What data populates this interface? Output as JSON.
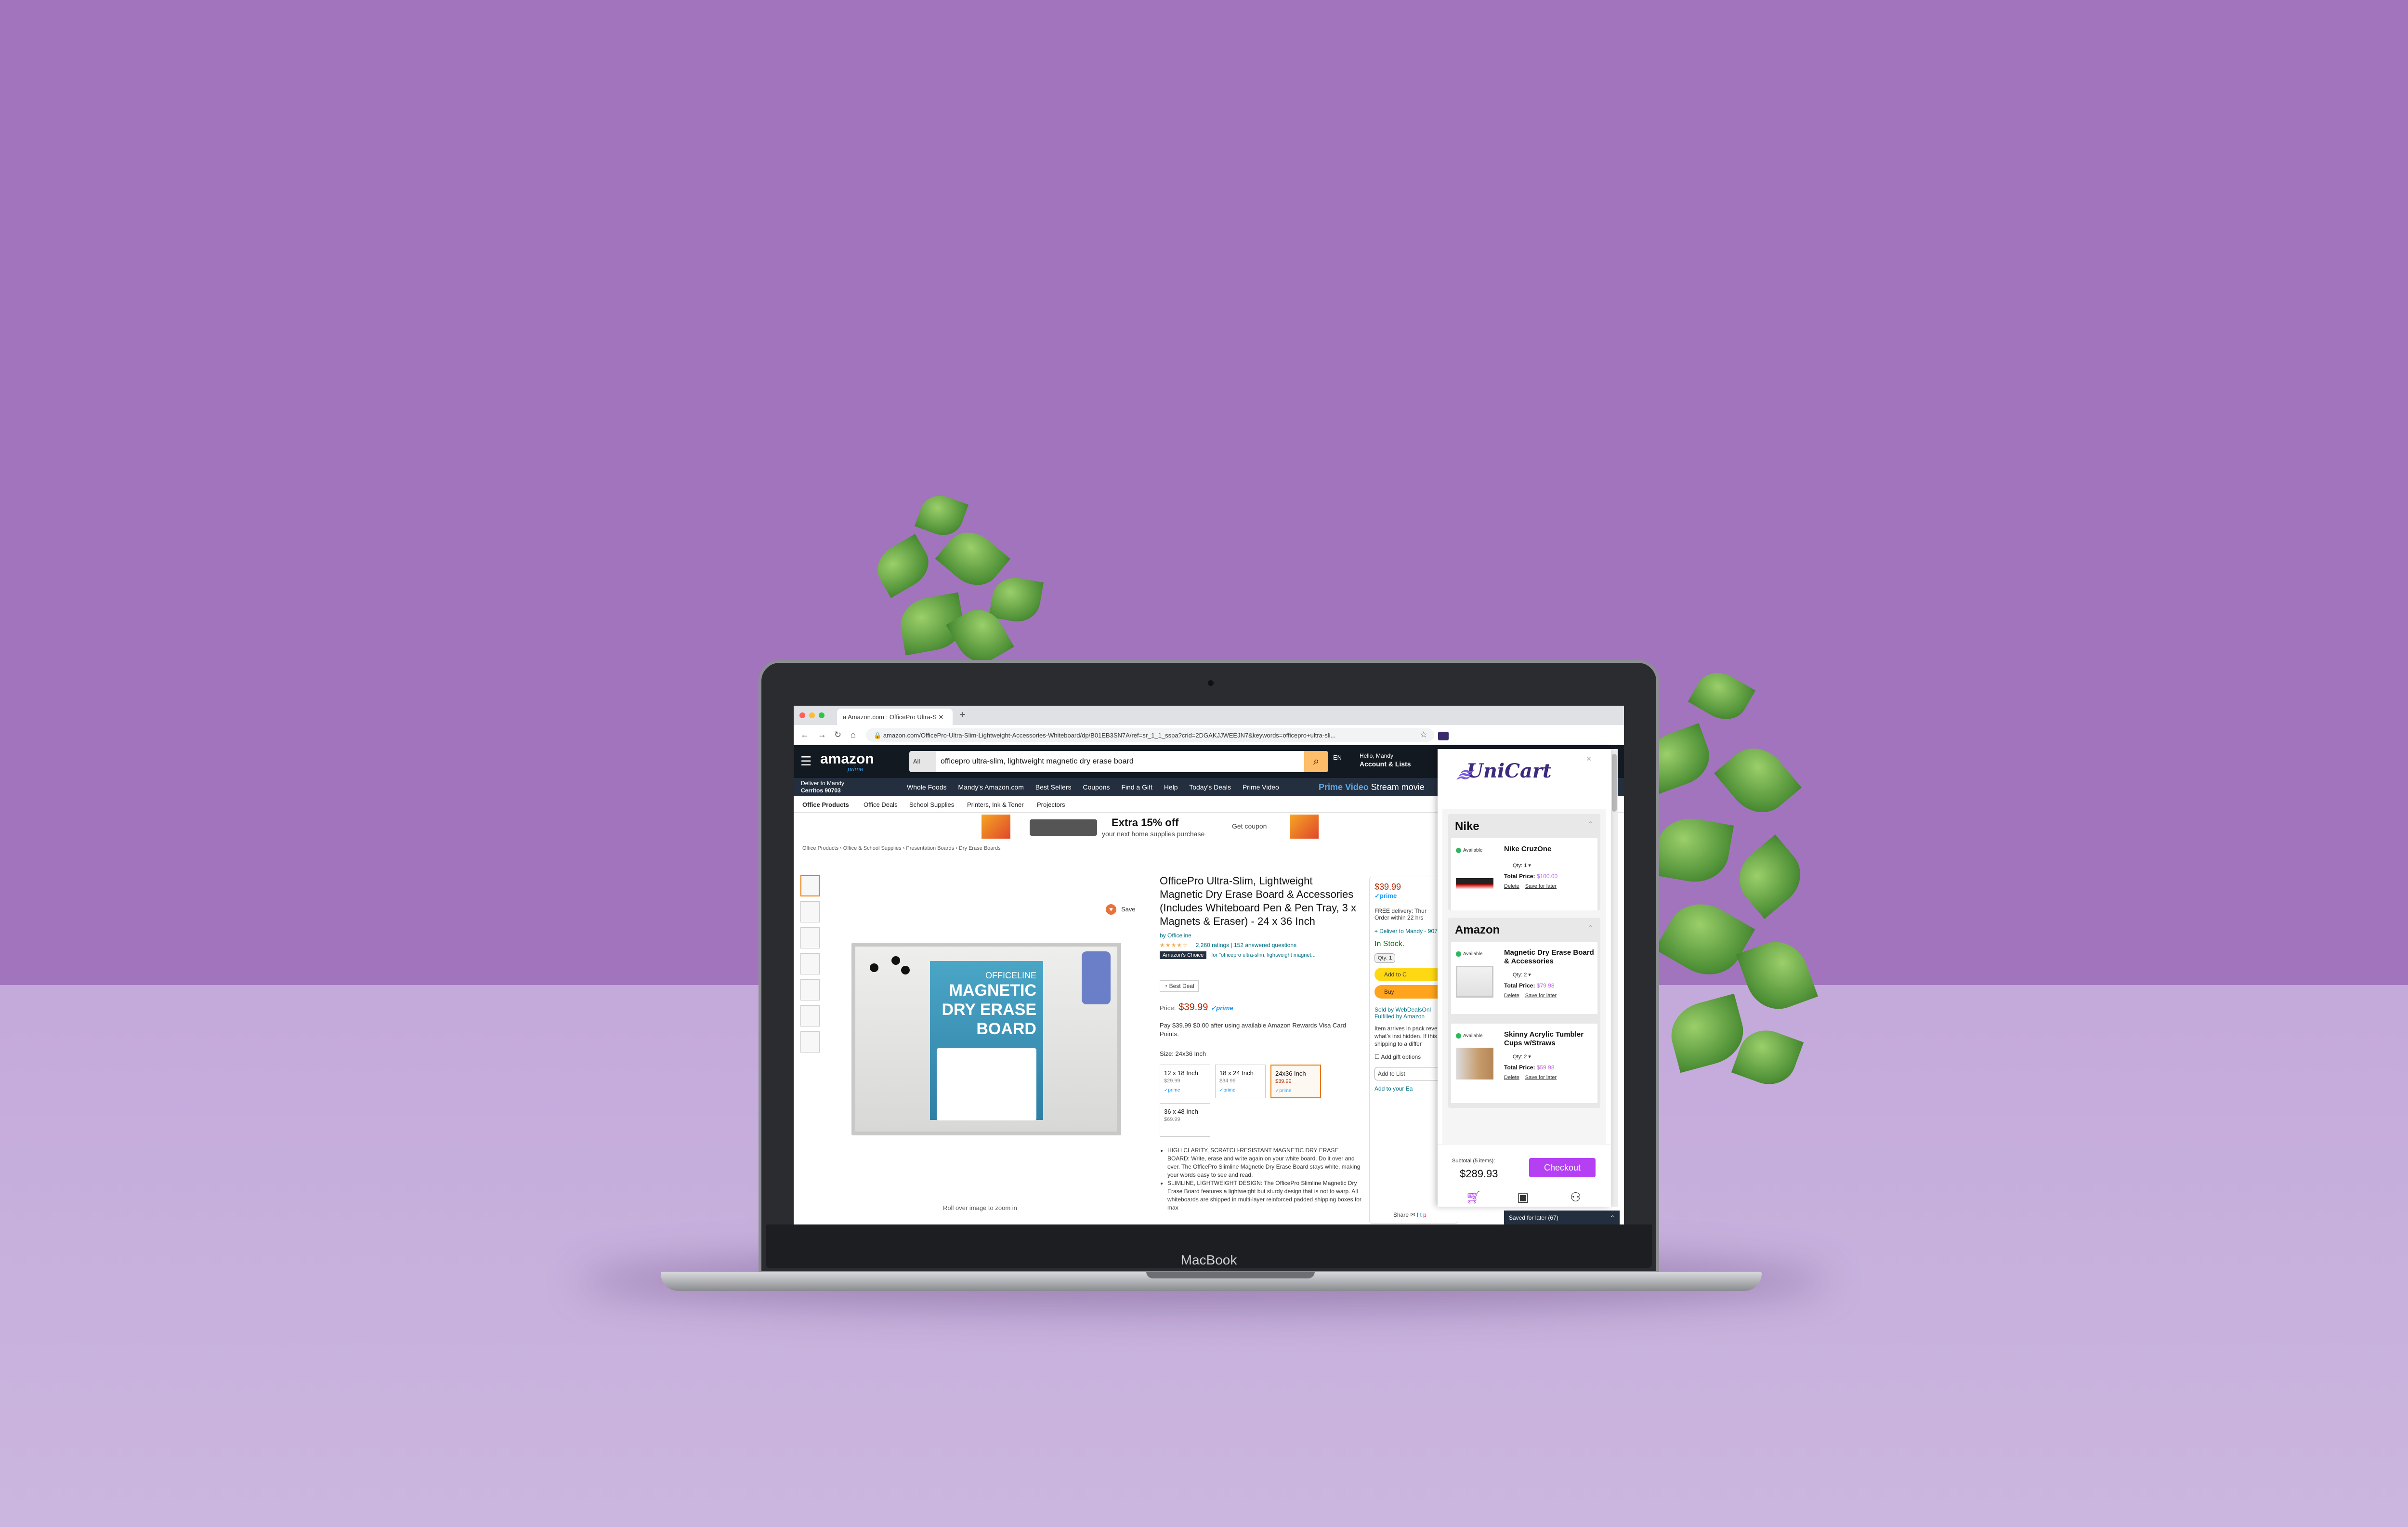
{
  "device": {
    "brand": "MacBook"
  },
  "browser": {
    "tab_title": "Amazon.com : OfficePro Ultra-S",
    "url": "amazon.com/OfficePro-Ultra-Slim-Lightweight-Accessories-Whiteboard/dp/B01EB3SN7A/ref=sr_1_1_sspa?crid=2DGAKJJWEEJN7&keywords=officepro+ultra-sli..."
  },
  "amazon": {
    "logo": "amazon",
    "prime": "prime",
    "search_category": "All",
    "search_query": "officepro ultra-slim, lightweight magnetic dry erase board",
    "lang": "EN",
    "greeting": "Hello, Mandy",
    "account": "Account & Lists",
    "deliver_label": "Deliver to Mandy",
    "deliver_location": "Cerritos 90703",
    "nav_links": [
      "Whole Foods",
      "Mandy's Amazon.com",
      "Best Sellers",
      "Coupons",
      "Find a Gift",
      "Help",
      "Today's Deals",
      "Prime Video"
    ],
    "prime_video_promo": "Prime Video",
    "prime_video_promo_rest": "Stream movie",
    "subnav": [
      "Office Products",
      "Office Deals",
      "School Supplies",
      "Printers, Ink & Toner",
      "Projectors"
    ],
    "banner_title": "Extra 15% off",
    "banner_sub": "your next home supplies purchase",
    "banner_cta": "Get coupon",
    "breadcrumbs": "Office Products › Office & School Supplies › Presentation Boards › Dry Erase Boards",
    "rollover": "Roll over image to zoom in",
    "save": "Save",
    "board_brand": "OFFICELINE",
    "board_line1": "MAGNETIC",
    "board_line2": "DRY ERASE",
    "board_line3": "BOARD",
    "product": {
      "title": "OfficePro Ultra-Slim, Lightweight Magnetic Dry Erase Board & Accessories (Includes Whiteboard Pen & Pen Tray, 3 x Magnets & Eraser) - 24 x 36 Inch",
      "by": "by Officeline",
      "ratings": "2,260 ratings",
      "answered": "152 answered questions",
      "choice_badge": "Amazon's Choice",
      "choice_for": "for \"officepro ultra-slim, lightweight magnet...",
      "best_deal": "Best Deal",
      "price_label": "Price:",
      "price": "$39.99",
      "prime": "✓prime",
      "pay_text": "Pay $39.99 $0.00 after using available Amazon Rewards Visa Card Points.",
      "size_label": "Size: 24x36 Inch",
      "sizes": [
        {
          "label": "12 x 18 Inch",
          "price": "$29.99",
          "prime": "✓prime"
        },
        {
          "label": "18 x 24 Inch",
          "price": "$34.99",
          "prime": "✓prime"
        },
        {
          "label": "24x36 Inch",
          "price": "$39.99",
          "prime": "✓prime"
        },
        {
          "label": "36 x 48 Inch",
          "price": "$69.99",
          "prime": ""
        }
      ],
      "bullets": [
        "HIGH CLARITY, SCRATCH-RESISTANT MAGNETIC DRY ERASE BOARD: Write, erase and write again on your white board. Do it over and over. The OfficePro Slimline Magnetic Dry Erase Board stays white, making your words easy to see and read.",
        "SLIMLINE, LIGHTWEIGHT DESIGN: The OfficePro Slimline Magnetic Dry Erase Board features a lightweight but sturdy design that is not to warp. All whiteboards are shipped in multi-layer reinforced padded shipping boxes for max"
      ]
    },
    "buybox": {
      "price": "$39.99",
      "prime": "✓prime",
      "delivery": "FREE delivery: Thur",
      "order_within": "Order within 22 hrs",
      "deliver_to": "Deliver to Mandy - 90703",
      "stock": "In Stock.",
      "qty": "Qty: 1",
      "add_to_cart": "Add to C",
      "buy_now": "Buy",
      "sold_by": "Sold by WebDealsOnl",
      "fulfilled": "Fulfilled by Amazon",
      "arrives": "Item arrives in pack reveals what's insi hidden. If this is a shipping to a differ",
      "gift": "Add gift options",
      "add_to_list": "Add to List",
      "add_to_your": "Add to your Ea",
      "share": "Share"
    }
  },
  "unicart": {
    "logo": "UniCart",
    "stores": [
      {
        "name": "Nike",
        "items": [
          {
            "status": "Available",
            "name": "Nike CruzOne",
            "qty": "Qty: 1",
            "total_label": "Total Price:",
            "total": "$100.00",
            "delete": "Delete",
            "save": "Save for later"
          }
        ]
      },
      {
        "name": "Amazon",
        "items": [
          {
            "status": "Available",
            "name": "Magnetic Dry Erase Board & Accessories",
            "qty": "Qty: 2",
            "total_label": "Total Price:",
            "total": "$79.98",
            "delete": "Delete",
            "save": "Save for later"
          },
          {
            "status": "Available",
            "name": "Skinny Acrylic Tumbler Cups w/Straws",
            "qty": "Qty: 2",
            "total_label": "Total Price:",
            "total": "$59.98",
            "delete": "Delete",
            "save": "Save for later"
          }
        ]
      }
    ],
    "subtotal_label": "Subtotal (5 items):",
    "subtotal": "$289.93",
    "checkout": "Checkout",
    "saved_for_later": "Saved for later (67)"
  }
}
